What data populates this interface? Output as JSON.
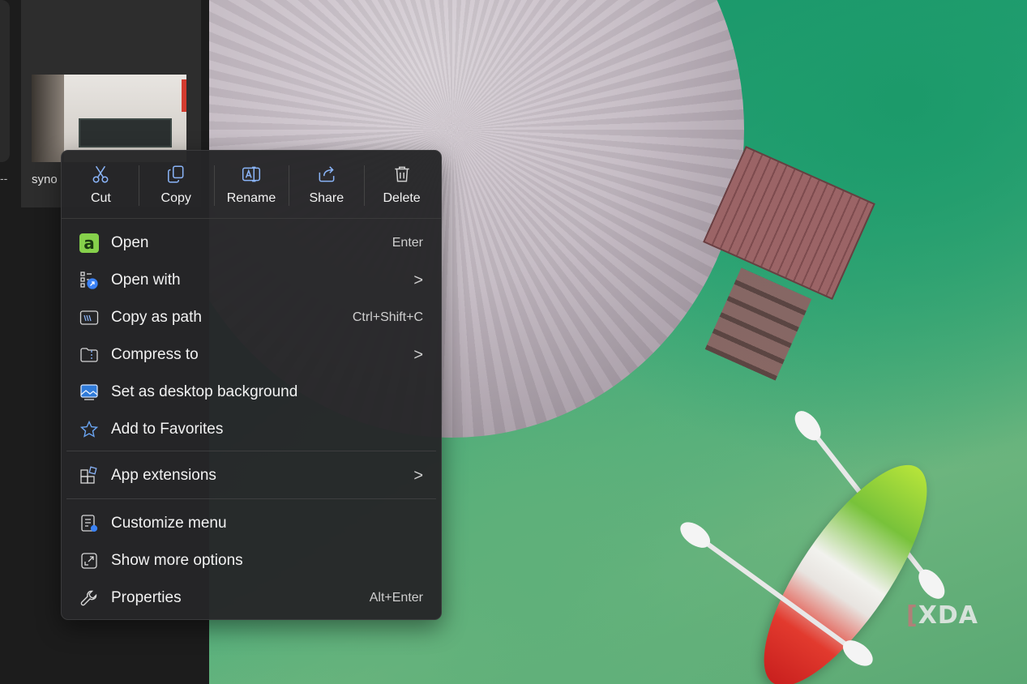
{
  "file": {
    "name_partial": "syno"
  },
  "quick_actions": [
    {
      "label": "Cut",
      "icon": "scissors-icon"
    },
    {
      "label": "Copy",
      "icon": "copy-icon"
    },
    {
      "label": "Rename",
      "icon": "rename-icon"
    },
    {
      "label": "Share",
      "icon": "share-icon"
    },
    {
      "label": "Delete",
      "icon": "trash-icon"
    }
  ],
  "menu_items": {
    "open": {
      "label": "Open",
      "shortcut": "Enter",
      "icon": "app-icon"
    },
    "open_with": {
      "label": "Open with",
      "icon": "open-with-icon",
      "submenu": true
    },
    "copy_as_path": {
      "label": "Copy as path",
      "shortcut": "Ctrl+Shift+C",
      "icon": "path-icon"
    },
    "compress_to": {
      "label": "Compress to",
      "icon": "zip-folder-icon",
      "submenu": true
    },
    "set_background": {
      "label": "Set as desktop background",
      "icon": "wallpaper-icon"
    },
    "add_favorites": {
      "label": "Add to Favorites",
      "icon": "star-icon"
    },
    "app_extensions": {
      "label": "App extensions",
      "icon": "extensions-icon",
      "submenu": true
    },
    "customize_menu": {
      "label": "Customize menu",
      "icon": "customize-icon"
    },
    "show_more": {
      "label": "Show more options",
      "icon": "expand-icon"
    },
    "properties": {
      "label": "Properties",
      "shortcut": "Alt+Enter",
      "icon": "wrench-icon"
    }
  },
  "chevron": ">",
  "open_icon_glyph": "a",
  "watermark": {
    "text": "XDA",
    "bracket": "["
  },
  "colors": {
    "menu_bg": "#262628",
    "open_icon_bg": "#86d14b",
    "text": "#f2f2f2"
  }
}
